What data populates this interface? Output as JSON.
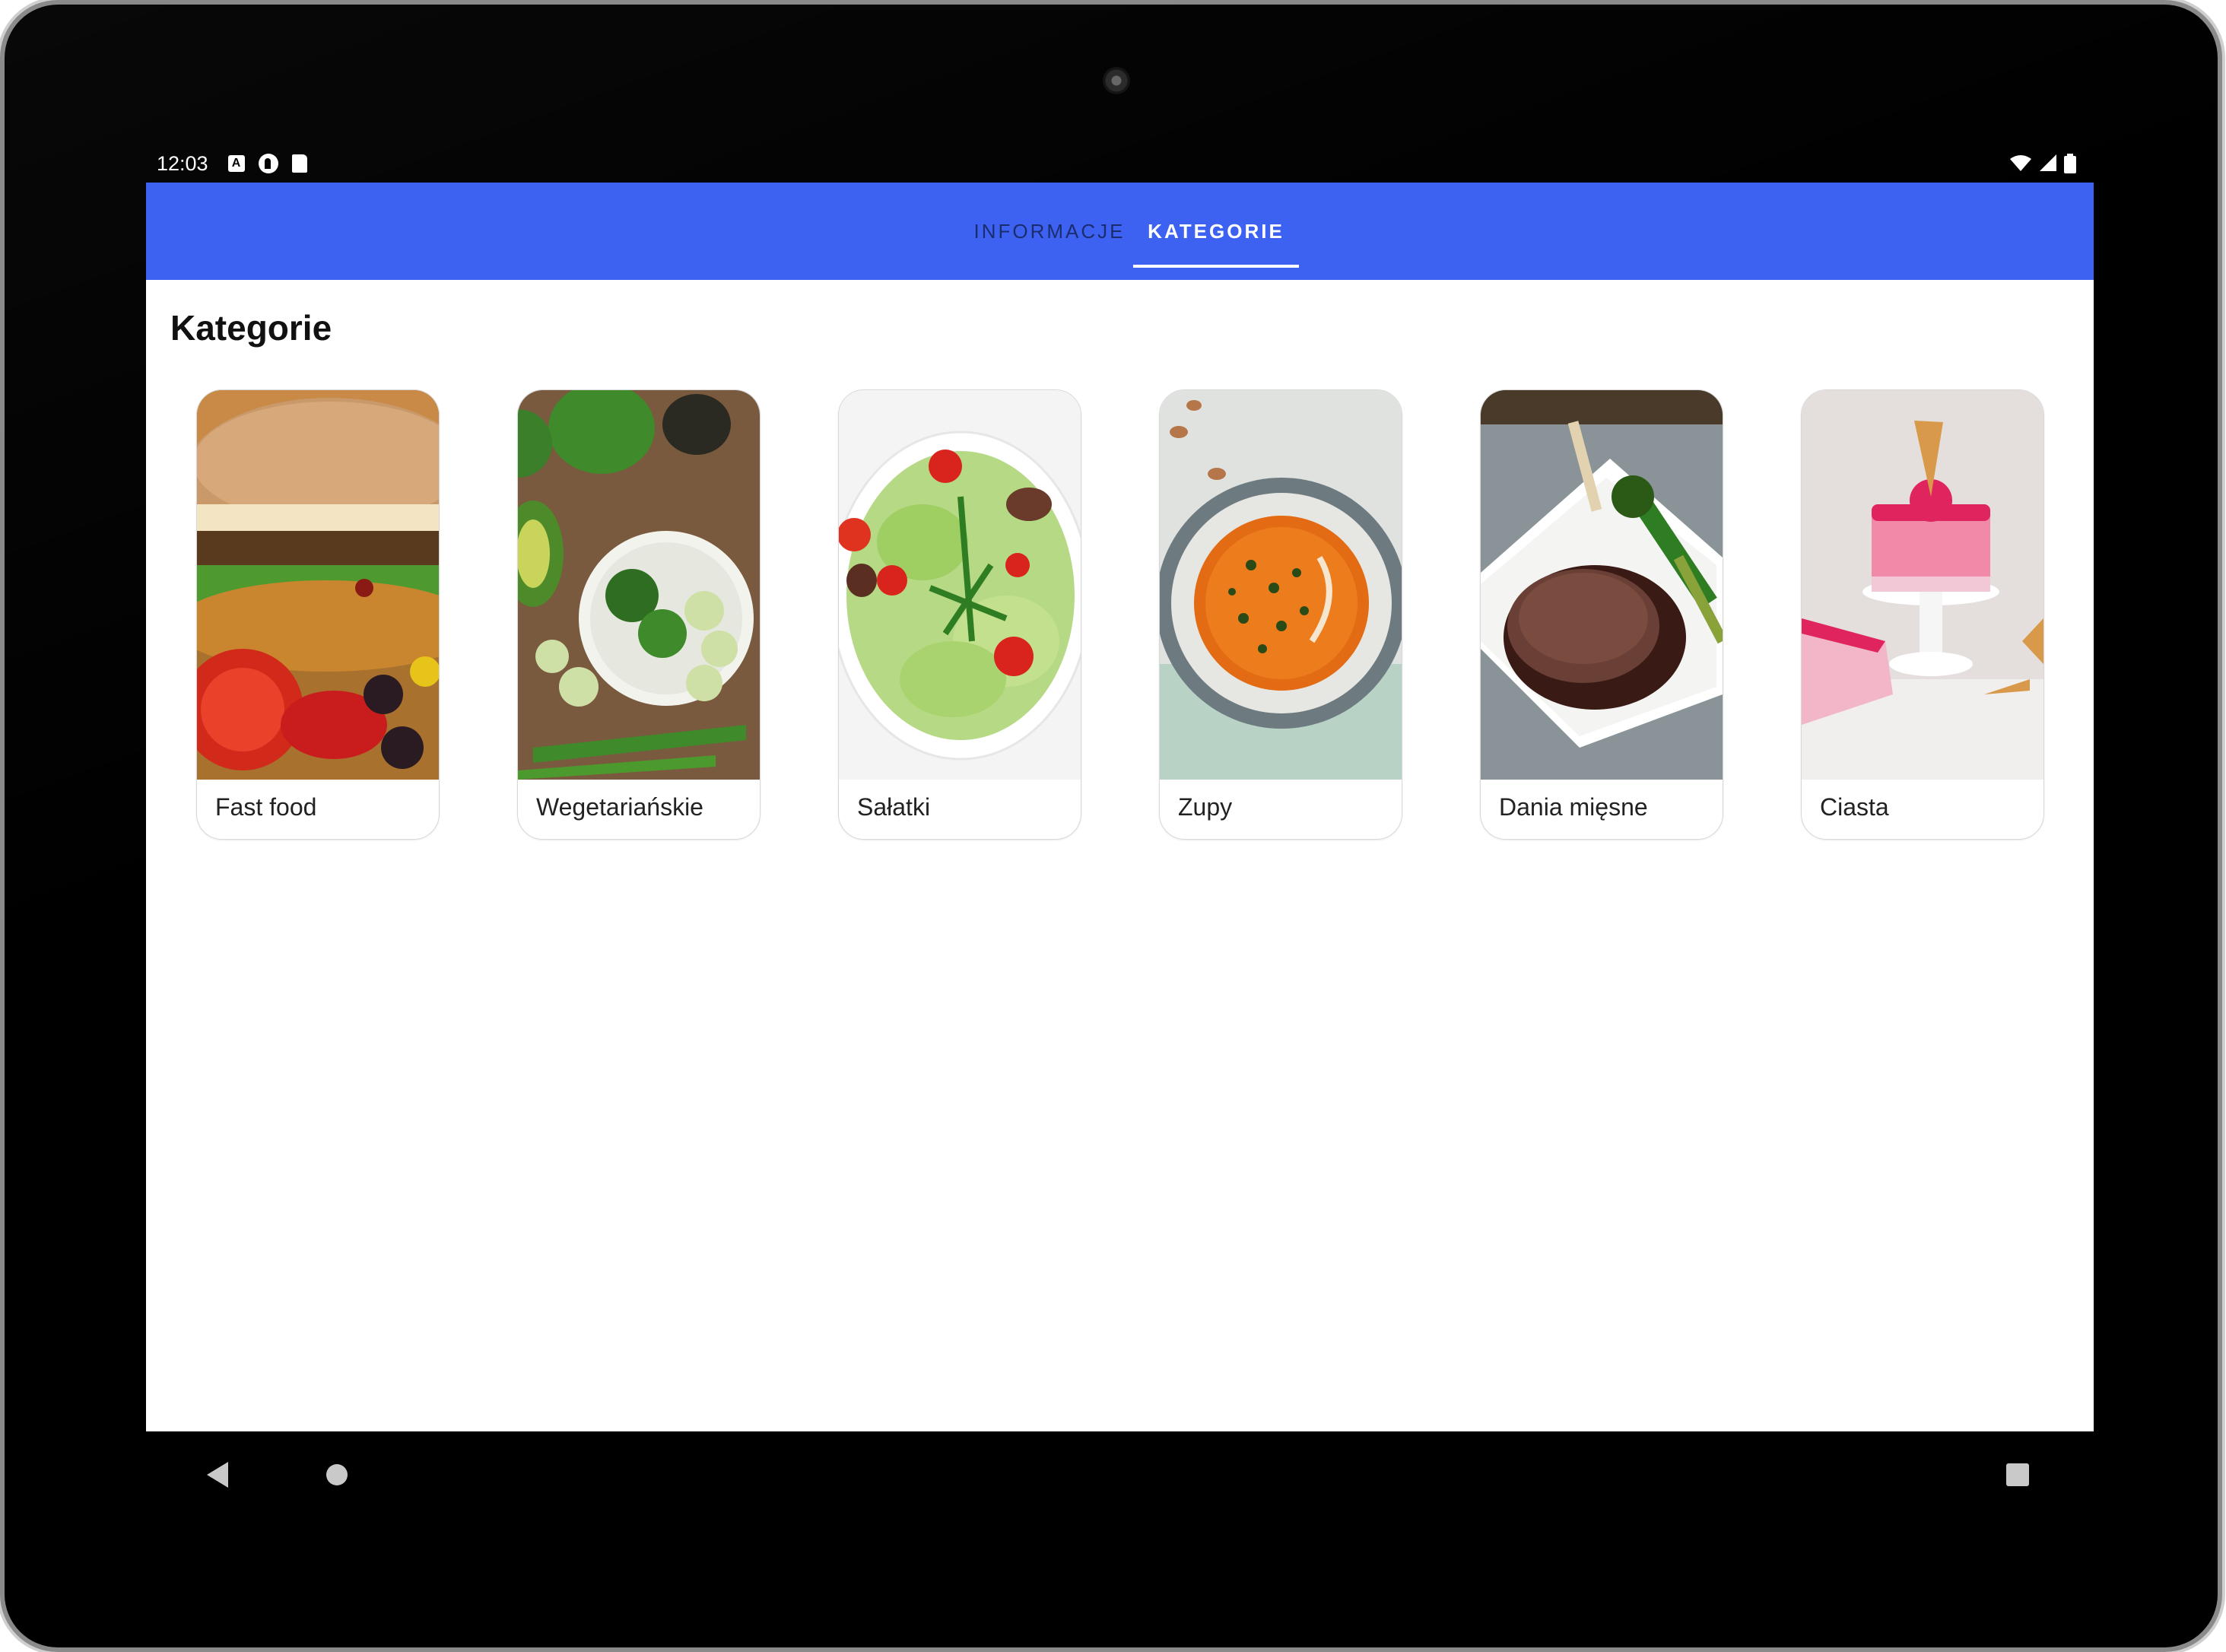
{
  "status_bar": {
    "time": "12:03",
    "left_icons": [
      "a-notification-icon",
      "f-notification-icon",
      "sd-card-icon"
    ],
    "right_icons": [
      "wifi-icon",
      "signal-icon",
      "battery-icon"
    ]
  },
  "tabs": [
    {
      "label": "INFORMACJE",
      "selected": false
    },
    {
      "label": "KATEGORIE",
      "selected": true
    }
  ],
  "colors": {
    "appbar": "#3d62f2",
    "background": "#ffffff"
  },
  "page": {
    "title": "Kategorie"
  },
  "categories": [
    {
      "label": "Fast food",
      "image": "burger-photo"
    },
    {
      "label": "Wegetariańskie",
      "image": "vegetables-photo"
    },
    {
      "label": "Sałatki",
      "image": "salad-photo"
    },
    {
      "label": "Zupy",
      "image": "tomato-soup-photo"
    },
    {
      "label": "Dania mięsne",
      "image": "steak-photo"
    },
    {
      "label": "Ciasta",
      "image": "cake-photo"
    }
  ],
  "nav_bar": [
    "back-icon",
    "home-icon",
    "recents-icon"
  ]
}
